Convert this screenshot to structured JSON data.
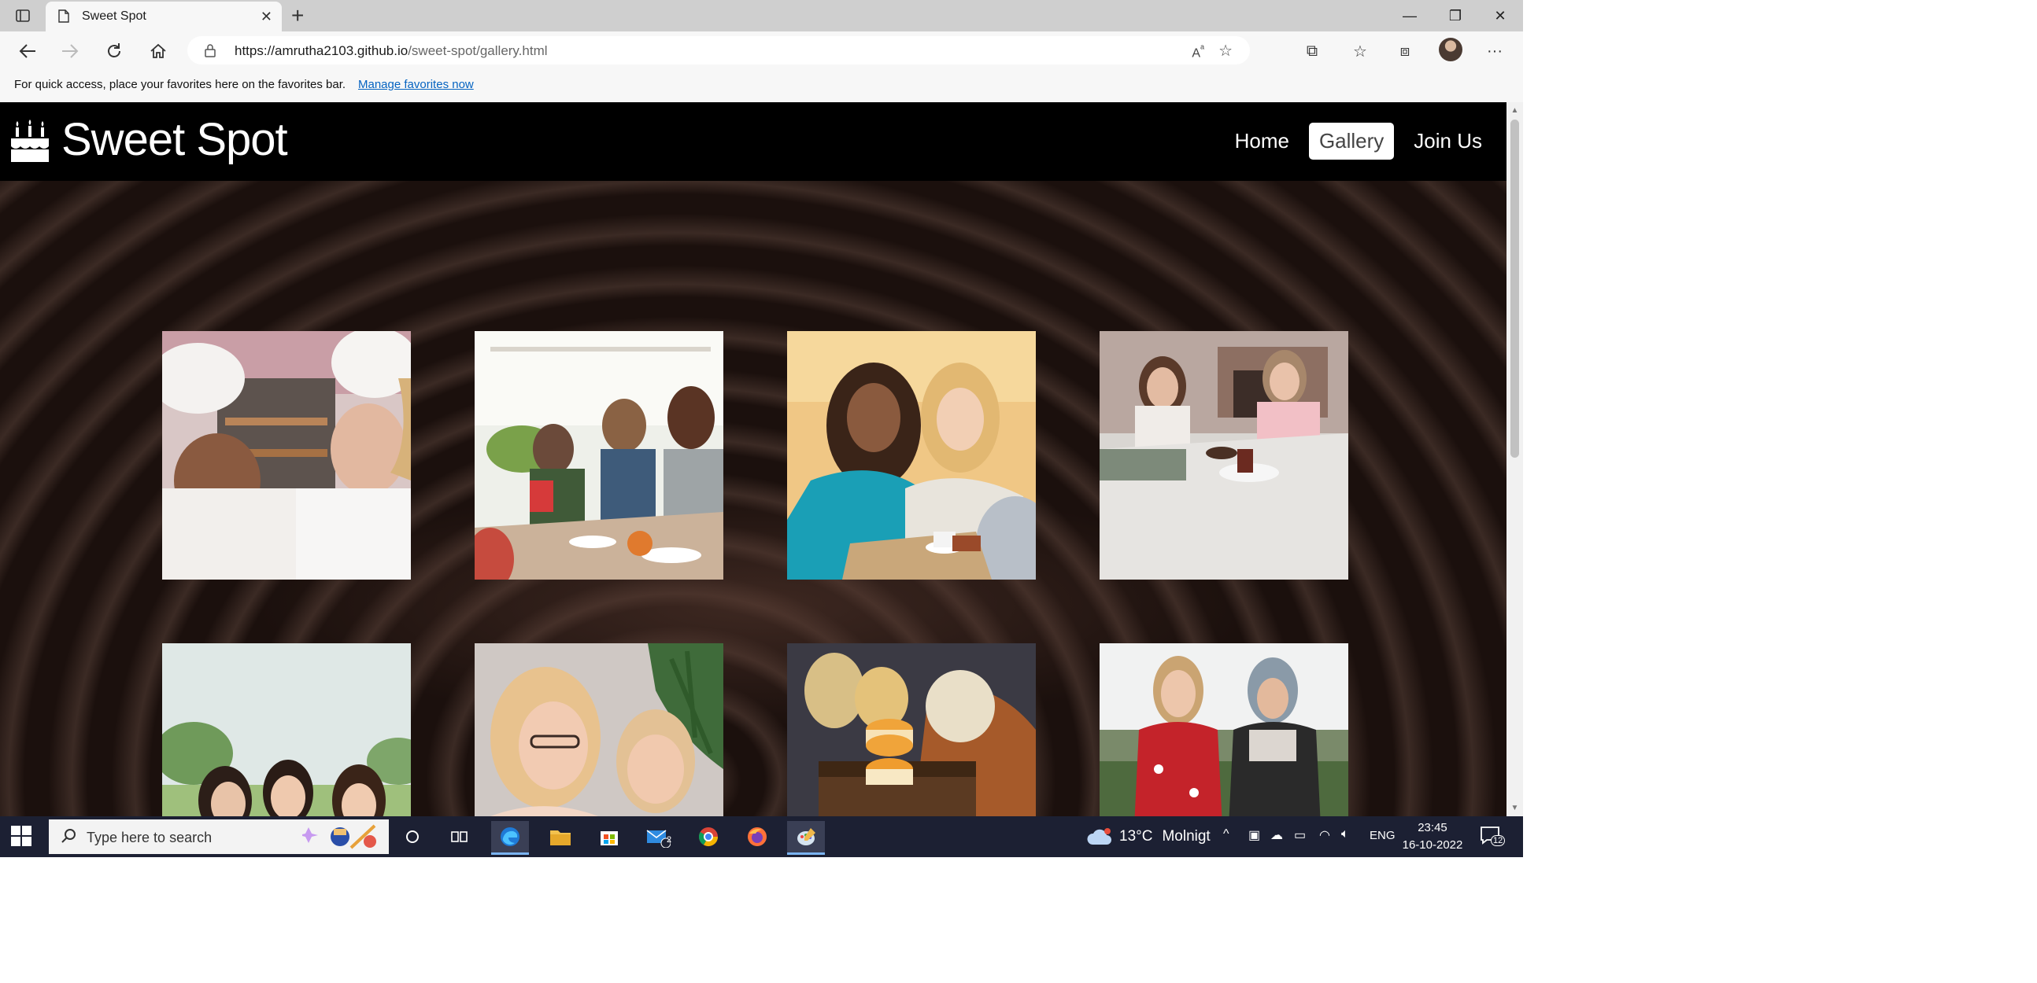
{
  "browser": {
    "tab_title": "Sweet Spot",
    "url_host": "https://amrutha2103.github.io",
    "url_path": "/sweet-spot/gallery.html",
    "favorites_message": "For quick access, place your favorites here on the favorites bar.",
    "favorites_link": "Manage favorites now"
  },
  "site": {
    "brand": "Sweet Spot",
    "nav": [
      "Home",
      "Gallery",
      "Join Us"
    ],
    "active_nav": "Gallery",
    "gallery": [
      {
        "subject": "bakers-pastry-kitchen"
      },
      {
        "subject": "friends-cafe-table"
      },
      {
        "subject": "women-laughing-coffee"
      },
      {
        "subject": "women-eating-dessert"
      },
      {
        "subject": "friends-picnic-outdoors"
      },
      {
        "subject": "women-tea-cups"
      },
      {
        "subject": "macarons-pumpkins-chest"
      },
      {
        "subject": "two-women-garden"
      }
    ]
  },
  "taskbar": {
    "search_placeholder": "Type here to search",
    "mail_badge": "2",
    "weather_temp": "13°C",
    "weather_desc": "Molnigt",
    "language": "ENG",
    "time": "23:45",
    "date": "16-10-2022",
    "notification_count": "12"
  },
  "colors": {
    "header_bg": "#000000",
    "nav_active_bg": "#ffffff",
    "link_blue": "#0563c1",
    "taskbar_bg": "#1c2033"
  }
}
